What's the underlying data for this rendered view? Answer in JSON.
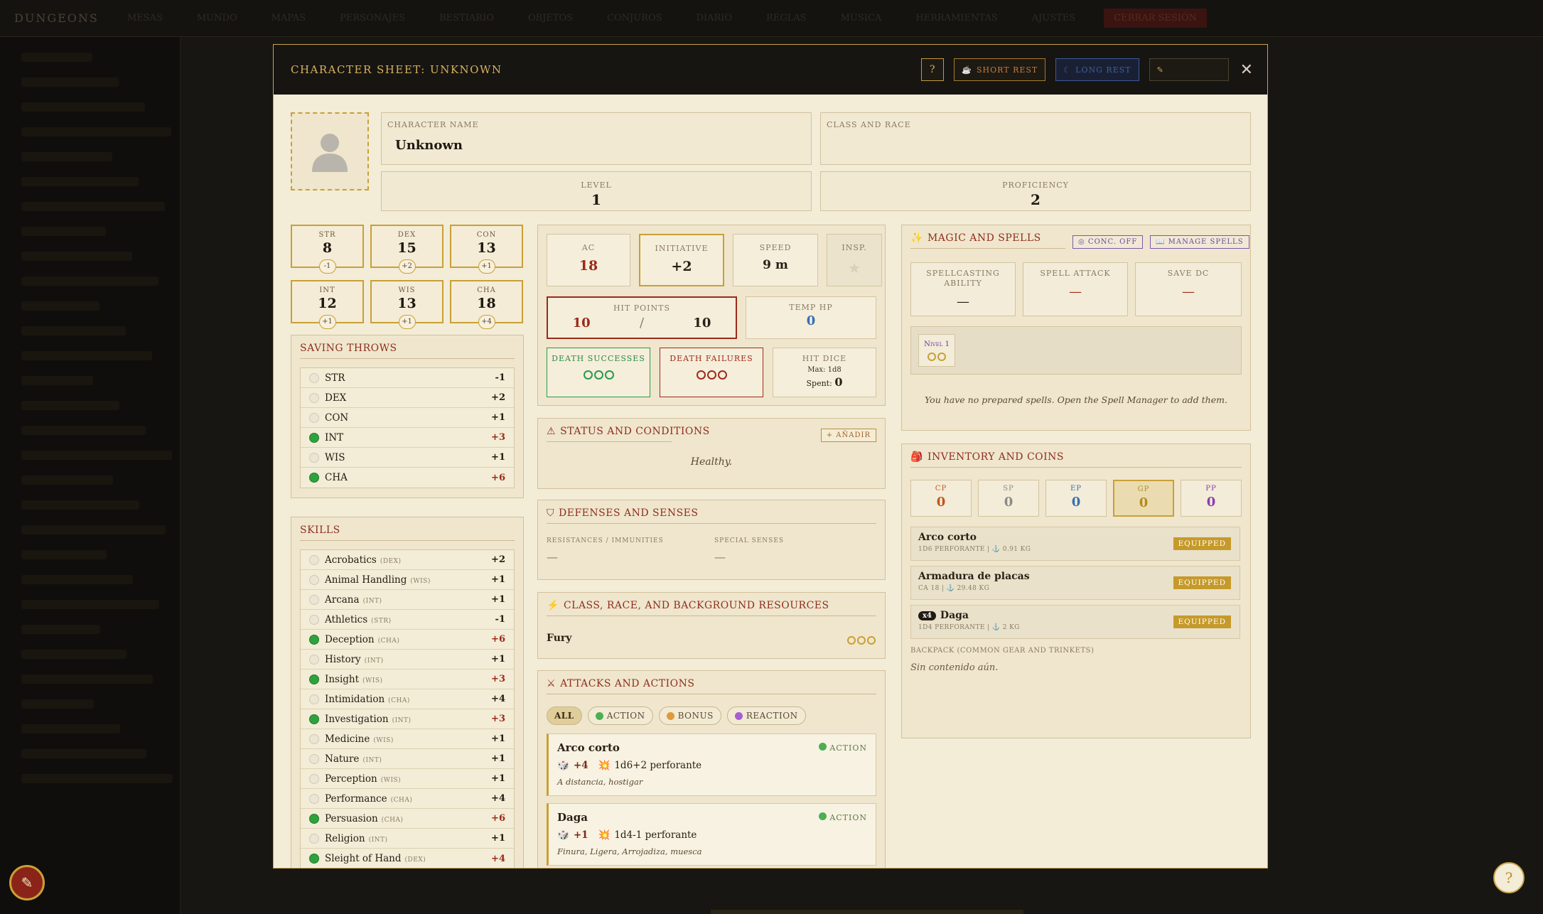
{
  "app": {
    "logo": "DUNGEONS",
    "nav": [
      "MESAS",
      "MUNDO",
      "MAPAS",
      "PERSONAJES",
      "BESTIARIO",
      "OBJETOS",
      "CONJUROS",
      "DIARIO",
      "REGLAS",
      "MÚSICA",
      "HERRAMIENTAS",
      "AJUSTES"
    ],
    "danger": "CERRAR SESIÓN"
  },
  "modal": {
    "title": "CHARACTER SHEET: UNKNOWN",
    "help": "?",
    "short_rest": "SHORT REST",
    "long_rest": "LONG REST",
    "close": "✕"
  },
  "info": {
    "name_label": "CHARACTER NAME",
    "name": "Unknown",
    "class_label": "CLASS AND RACE",
    "class": "",
    "level_label": "LEVEL",
    "level": "1",
    "prof_label": "PROFICIENCY",
    "prof": "2"
  },
  "abilities": [
    {
      "label": "STR",
      "score": "8",
      "mod": "-1"
    },
    {
      "label": "DEX",
      "score": "15",
      "mod": "+2"
    },
    {
      "label": "CON",
      "score": "13",
      "mod": "+1"
    },
    {
      "label": "INT",
      "score": "12",
      "mod": "+1"
    },
    {
      "label": "WIS",
      "score": "13",
      "mod": "+1"
    },
    {
      "label": "CHA",
      "score": "18",
      "mod": "+4"
    }
  ],
  "saves": {
    "title": "SAVING THROWS",
    "items": [
      {
        "name": "STR",
        "val": "-1",
        "prof": false
      },
      {
        "name": "DEX",
        "val": "+2",
        "prof": false
      },
      {
        "name": "CON",
        "val": "+1",
        "prof": false
      },
      {
        "name": "INT",
        "val": "+3",
        "prof": true
      },
      {
        "name": "WIS",
        "val": "+1",
        "prof": false
      },
      {
        "name": "CHA",
        "val": "+6",
        "prof": true
      }
    ]
  },
  "skills": {
    "title": "SKILLS",
    "items": [
      {
        "name": "Acrobatics",
        "attr": "(DEX)",
        "val": "+2",
        "prof": false
      },
      {
        "name": "Animal Handling",
        "attr": "(WIS)",
        "val": "+1",
        "prof": false
      },
      {
        "name": "Arcana",
        "attr": "(INT)",
        "val": "+1",
        "prof": false
      },
      {
        "name": "Athletics",
        "attr": "(STR)",
        "val": "-1",
        "prof": false
      },
      {
        "name": "Deception",
        "attr": "(CHA)",
        "val": "+6",
        "prof": true
      },
      {
        "name": "History",
        "attr": "(INT)",
        "val": "+1",
        "prof": false
      },
      {
        "name": "Insight",
        "attr": "(WIS)",
        "val": "+3",
        "prof": true
      },
      {
        "name": "Intimidation",
        "attr": "(CHA)",
        "val": "+4",
        "prof": false
      },
      {
        "name": "Investigation",
        "attr": "(INT)",
        "val": "+3",
        "prof": true
      },
      {
        "name": "Medicine",
        "attr": "(WIS)",
        "val": "+1",
        "prof": false
      },
      {
        "name": "Nature",
        "attr": "(INT)",
        "val": "+1",
        "prof": false
      },
      {
        "name": "Perception",
        "attr": "(WIS)",
        "val": "+1",
        "prof": false
      },
      {
        "name": "Performance",
        "attr": "(CHA)",
        "val": "+4",
        "prof": false
      },
      {
        "name": "Persuasion",
        "attr": "(CHA)",
        "val": "+6",
        "prof": true
      },
      {
        "name": "Religion",
        "attr": "(INT)",
        "val": "+1",
        "prof": false
      },
      {
        "name": "Sleight of Hand",
        "attr": "(DEX)",
        "val": "+4",
        "prof": true
      }
    ]
  },
  "combat": {
    "ac_label": "AC",
    "ac": "18",
    "init_label": "INITIATIVE",
    "init": "+2",
    "speed_label": "SPEED",
    "speed": "9 m",
    "insp_label": "INSP.",
    "hp_label": "HIT POINTS",
    "hp_cur": "10",
    "hp_sep": "/",
    "hp_max": "10",
    "temp_label": "TEMP HP",
    "temp": "0",
    "ds_label": "DEATH SUCCESSES",
    "df_label": "DEATH FAILURES",
    "hd_label": "HIT DICE",
    "hd_max": "Max: 1d8",
    "hd_spent_label": "Spent:",
    "hd_spent": "0"
  },
  "status": {
    "title": "STATUS AND CONDITIONS",
    "add": "+ AÑADIR",
    "text": "Healthy."
  },
  "defenses": {
    "title": "DEFENSES AND SENSES",
    "res_label": "RESISTANCES / IMMUNITIES",
    "res": "—",
    "senses_label": "SPECIAL SENSES",
    "senses": "—"
  },
  "resources": {
    "title": "CLASS, RACE, AND BACKGROUND RESOURCES",
    "name": "Fury"
  },
  "attacks": {
    "title": "ATTACKS AND ACTIONS",
    "filters": [
      "ALL",
      "ACTION",
      "BONUS",
      "REACTION"
    ],
    "filter_colors": [
      "",
      "#4caf50",
      "#e09a3a",
      "#a65fd0"
    ],
    "items": [
      {
        "name": "Arco corto",
        "type": "ACTION",
        "bonus": "+4",
        "damage": "1d6+2 perforante",
        "props": "A distancia, hostigar"
      },
      {
        "name": "Daga",
        "type": "ACTION",
        "bonus": "+1",
        "damage": "1d4-1 perforante",
        "props": "Finura, Ligera, Arrojadiza, muesca"
      }
    ]
  },
  "magic": {
    "title": "MAGIC AND SPELLS",
    "conc": "CONC. OFF",
    "manage": "MANAGE SPELLS",
    "ability_label": "SPELLCASTING ABILITY",
    "ability": "—",
    "attack_label": "SPELL ATTACK",
    "attack": "—",
    "dc_label": "SAVE DC",
    "dc": "—",
    "slot_level": "Nivel 1",
    "empty": "You have no prepared spells. Open the Spell Manager to add them."
  },
  "inventory": {
    "title": "INVENTORY AND COINS",
    "coins": [
      {
        "label": "CP",
        "val": "0",
        "color": "#c0561c"
      },
      {
        "label": "SP",
        "val": "0",
        "color": "#8a8a8a"
      },
      {
        "label": "EP",
        "val": "0",
        "color": "#3a6fb0"
      },
      {
        "label": "GP",
        "val": "0",
        "color": "#b58a1e"
      },
      {
        "label": "PP",
        "val": "0",
        "color": "#8a3fb0"
      }
    ],
    "items": [
      {
        "name": "Arco corto",
        "qty": "",
        "desc": "1D6 PERFORANTE | ⚓ 0.91 KG",
        "status": "EQUIPPED"
      },
      {
        "name": "Armadura de placas",
        "qty": "",
        "desc": "CA 18 | ⚓ 29.48 KG",
        "status": "EQUIPPED"
      },
      {
        "name": "Daga",
        "qty": "x4",
        "desc": "1D4 PERFORANTE | ⚓ 2 KG",
        "status": "EQUIPPED"
      }
    ],
    "backpack_label": "BACKPACK (COMMON GEAR AND TRINKETS)",
    "backpack_empty": "Sin contenido aún."
  },
  "float": {
    "help": "?"
  }
}
